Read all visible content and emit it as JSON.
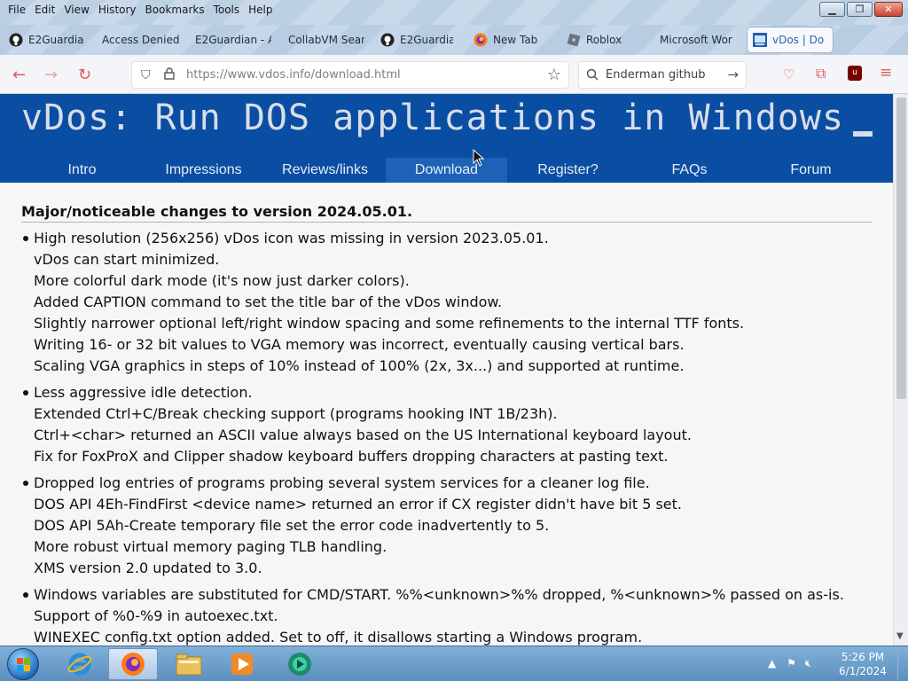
{
  "menu": [
    "File",
    "Edit",
    "View",
    "History",
    "Bookmarks",
    "Tools",
    "Help"
  ],
  "tabs": [
    {
      "label": "E2Guardian",
      "icon": "github-icon"
    },
    {
      "label": "Access Denied",
      "icon": "blank-icon"
    },
    {
      "label": "E2Guardian - A",
      "icon": "blank-icon"
    },
    {
      "label": "CollabVM Sear",
      "icon": "blank-icon"
    },
    {
      "label": "E2Guardian",
      "icon": "github-icon"
    },
    {
      "label": "New Tab",
      "icon": "firefox-icon"
    },
    {
      "label": "Roblox",
      "icon": "roblox-icon"
    },
    {
      "label": "Microsoft Wor",
      "icon": "blank-icon"
    },
    {
      "label": "vDos | Do",
      "icon": "vdos-icon"
    }
  ],
  "toolbar": {
    "url": "https://www.vdos.info/download.html",
    "search_value": "Enderman github"
  },
  "site": {
    "title": "vDos: Run DOS applications in Windows",
    "nav": [
      "Intro",
      "Impressions",
      "Reviews/links",
      "Download",
      "Register?",
      "FAQs",
      "Forum"
    ],
    "selected_nav": "Download"
  },
  "content": {
    "heading": "Major/noticeable changes to version 2024.05.01.",
    "groups": [
      [
        "High resolution (256x256) vDos icon was missing in version 2023.05.01.",
        "vDos can start minimized.",
        "More colorful dark mode (it's now just darker colors).",
        "Added CAPTION command to set the title bar of the vDos window.",
        "Slightly narrower optional left/right window spacing and some refinements to the internal TTF fonts.",
        "Writing 16- or 32 bit values to VGA memory was incorrect, eventually causing vertical bars.",
        "Scaling VGA graphics in steps of 10% instead of 100% (2x, 3x...) and supported at runtime."
      ],
      [
        "Less aggressive idle detection.",
        "Extended Ctrl+C/Break checking support (programs hooking INT 1B/23h).",
        "Ctrl+<char> returned an ASCII value always based on the US International keyboard layout.",
        "Fix for FoxProX and Clipper shadow keyboard buffers dropping characters at pasting text."
      ],
      [
        "Dropped log entries of programs probing several system services for a cleaner log file.",
        "DOS API 4Eh-FindFirst <device name> returned an error if CX register didn't have bit 5 set.",
        "DOS API 5Ah-Create temporary file set the error code inadvertently to 5.",
        "More robust virtual memory paging TLB handling.",
        "XMS version 2.0 updated to 3.0."
      ],
      [
        "Windows variables are substituted for CMD/START. %%<unknown>%% dropped, %<unknown>% passed on as-is.",
        "Support of %0-%9 in autoexec.txt.",
        "WINEXEC config.txt option added. Set to off, it disallows starting a Windows program."
      ]
    ]
  },
  "taskbar": {
    "apps": [
      "internet-explorer-icon",
      "firefox-icon",
      "file-explorer-icon",
      "media-player-icon",
      "app-icon"
    ],
    "time": "5:26 PM",
    "date": "6/1/2024"
  },
  "colors": {
    "banner": "#0a4ea3",
    "nav_selected": "#1d62b7",
    "page_bg": "#f6f6f6"
  }
}
